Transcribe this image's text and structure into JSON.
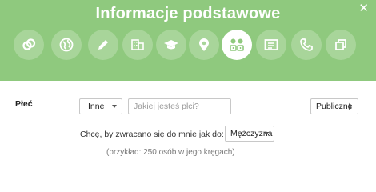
{
  "header": {
    "title": "Informacje podstawowe",
    "close_icon": "close-icon",
    "bg_color": "#8fc97e",
    "section_icons": [
      {
        "name": "ring-icon",
        "active": false
      },
      {
        "name": "globe-icon",
        "active": false
      },
      {
        "name": "pencil-icon",
        "active": false
      },
      {
        "name": "building-icon",
        "active": false
      },
      {
        "name": "graduation-cap-icon",
        "active": false
      },
      {
        "name": "location-pin-icon",
        "active": false
      },
      {
        "name": "gender-icon",
        "active": true
      },
      {
        "name": "contact-card-icon",
        "active": false
      },
      {
        "name": "phone-icon",
        "active": false
      },
      {
        "name": "copy-icon",
        "active": false
      }
    ]
  },
  "form": {
    "gender_label": "Płeć",
    "gender_select_value": "Inne",
    "gender_input_placeholder": "Jakiej jesteś płci?",
    "gender_input_value": "",
    "visibility_value": "Publiczne",
    "pronoun_label": "Chcę, by zwracano się do mnie jak do:",
    "pronoun_select_value": "Mężczyzna",
    "example_text": "(przykład: 250 osób w jego kręgach)"
  }
}
